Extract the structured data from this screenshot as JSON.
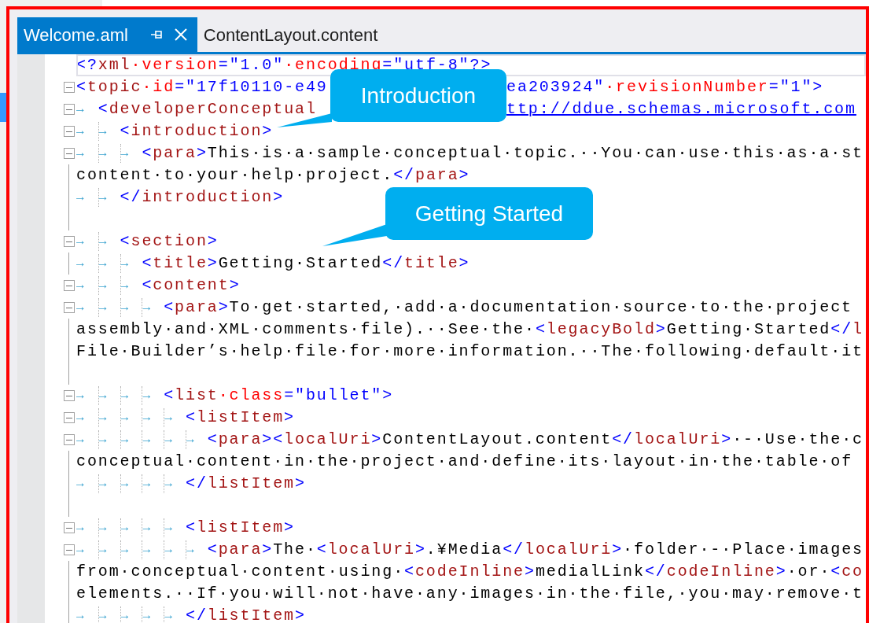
{
  "tabs": [
    {
      "label": "Welcome.aml",
      "selected": true
    },
    {
      "label": "ContentLayout.content",
      "selected": false
    }
  ],
  "editor": {
    "lines": [
      {
        "fold": false,
        "current": true,
        "tokens": [
          {
            "kind": "bracket",
            "text": "<?"
          },
          {
            "kind": "tag",
            "text": "xml"
          },
          {
            "kind": "attr",
            "text": "·version"
          },
          {
            "kind": "bracket",
            "text": "="
          },
          {
            "kind": "value",
            "text": "\"1.0\""
          },
          {
            "kind": "attr",
            "text": "·encoding"
          },
          {
            "kind": "bracket",
            "text": "="
          },
          {
            "kind": "value",
            "text": "\"utf-8\""
          },
          {
            "kind": "bracket",
            "text": "?>"
          }
        ]
      },
      {
        "fold": true,
        "current": false,
        "tokens": [
          {
            "kind": "bracket",
            "text": "<"
          },
          {
            "kind": "tag",
            "text": "topic"
          },
          {
            "kind": "attr",
            "text": "·id"
          },
          {
            "kind": "bracket",
            "text": "="
          },
          {
            "kind": "value",
            "text": "\"17f10110-e49"
          },
          {
            "kind": "hidden"
          },
          {
            "kind": "value",
            "text": "ea203924\""
          },
          {
            "kind": "attr",
            "text": "·revisionNumber"
          },
          {
            "kind": "bracket",
            "text": "="
          },
          {
            "kind": "value",
            "text": "\"1\""
          },
          {
            "kind": "bracket",
            "text": ">"
          }
        ]
      },
      {
        "fold": true,
        "current": false,
        "tabs": [
          "→"
        ],
        "tokens": [
          {
            "kind": "bracket",
            "text": "<"
          },
          {
            "kind": "tag",
            "text": "developerConceptual"
          },
          {
            "kind": "hidden"
          },
          {
            "kind": "link",
            "text": "ttp://ddue.schemas.microsoft.com"
          }
        ]
      },
      {
        "fold": true,
        "current": false,
        "tabs": [
          "→",
          "→"
        ],
        "tokens": [
          {
            "kind": "bracket",
            "text": "<"
          },
          {
            "kind": "tag",
            "text": "introduction"
          },
          {
            "kind": "bracket",
            "text": ">"
          }
        ]
      },
      {
        "fold": true,
        "current": false,
        "tabs": [
          "→",
          "→",
          "→"
        ],
        "tokens": [
          {
            "kind": "bracket",
            "text": "<"
          },
          {
            "kind": "tag",
            "text": "para"
          },
          {
            "kind": "bracket",
            "text": ">"
          },
          {
            "kind": "text",
            "text": "This·is·a·sample·conceptual·topic.··You·can·use·this·as·a·st"
          }
        ]
      },
      {
        "fold": false,
        "current": false,
        "tokens": [
          {
            "kind": "text",
            "text": "content·to·your·help·project."
          },
          {
            "kind": "bracket",
            "text": "</"
          },
          {
            "kind": "tag",
            "text": "para"
          },
          {
            "kind": "bracket",
            "text": ">"
          }
        ]
      },
      {
        "fold": false,
        "current": false,
        "tabs": [
          "→",
          "→"
        ],
        "tokens": [
          {
            "kind": "bracket",
            "text": "</"
          },
          {
            "kind": "tag",
            "text": "introduction"
          },
          {
            "kind": "bracket",
            "text": ">"
          }
        ]
      },
      {
        "fold": false,
        "current": false
      },
      {
        "fold": true,
        "current": false,
        "tabs": [
          "→",
          "→"
        ],
        "tokens": [
          {
            "kind": "bracket",
            "text": "<"
          },
          {
            "kind": "tag",
            "text": "section"
          },
          {
            "kind": "bracket",
            "text": ">"
          }
        ]
      },
      {
        "fold": false,
        "current": false,
        "tabs": [
          "→",
          "→",
          "→"
        ],
        "tokens": [
          {
            "kind": "bracket",
            "text": "<"
          },
          {
            "kind": "tag",
            "text": "title"
          },
          {
            "kind": "bracket",
            "text": ">"
          },
          {
            "kind": "text",
            "text": "Getting·Started"
          },
          {
            "kind": "bracket",
            "text": "</"
          },
          {
            "kind": "tag",
            "text": "title"
          },
          {
            "kind": "bracket",
            "text": ">"
          }
        ]
      },
      {
        "fold": true,
        "current": false,
        "tabs": [
          "→",
          "→",
          "→"
        ],
        "tokens": [
          {
            "kind": "bracket",
            "text": "<"
          },
          {
            "kind": "tag",
            "text": "content"
          },
          {
            "kind": "bracket",
            "text": ">"
          }
        ]
      },
      {
        "fold": true,
        "current": false,
        "tabs": [
          "→",
          "→",
          "→",
          "→"
        ],
        "tokens": [
          {
            "kind": "bracket",
            "text": "<"
          },
          {
            "kind": "tag",
            "text": "para"
          },
          {
            "kind": "bracket",
            "text": ">"
          },
          {
            "kind": "text",
            "text": "To·get·started,·add·a·documentation·source·to·the·project"
          }
        ]
      },
      {
        "fold": false,
        "current": false,
        "tokens": [
          {
            "kind": "text",
            "text": "assembly·and·XML·comments·file).··See·the·"
          },
          {
            "kind": "bracket",
            "text": "<"
          },
          {
            "kind": "tag",
            "text": "legacyBold"
          },
          {
            "kind": "bracket",
            "text": ">"
          },
          {
            "kind": "text",
            "text": "Getting·Started"
          },
          {
            "kind": "bracket",
            "text": "</"
          },
          {
            "kind": "tag",
            "text": "l"
          }
        ]
      },
      {
        "fold": false,
        "current": false,
        "tokens": [
          {
            "kind": "text",
            "text": "File·Builder’s·help·file·for·more·information.··The·following·default·it"
          }
        ]
      },
      {
        "fold": false,
        "current": false
      },
      {
        "fold": true,
        "current": false,
        "tabs": [
          "→",
          "→",
          "→",
          "→"
        ],
        "tokens": [
          {
            "kind": "bracket",
            "text": "<"
          },
          {
            "kind": "tag",
            "text": "list"
          },
          {
            "kind": "attr",
            "text": "·class"
          },
          {
            "kind": "bracket",
            "text": "="
          },
          {
            "kind": "value",
            "text": "\"bullet\""
          },
          {
            "kind": "bracket",
            "text": ">"
          }
        ]
      },
      {
        "fold": true,
        "current": false,
        "tabs": [
          "→",
          "→",
          "→",
          "→",
          "→"
        ],
        "tokens": [
          {
            "kind": "bracket",
            "text": "<"
          },
          {
            "kind": "tag",
            "text": "listItem"
          },
          {
            "kind": "bracket",
            "text": ">"
          }
        ]
      },
      {
        "fold": true,
        "current": false,
        "tabs": [
          "→",
          "→",
          "→",
          "→",
          "→",
          "→"
        ],
        "tokens": [
          {
            "kind": "bracket",
            "text": "<"
          },
          {
            "kind": "tag",
            "text": "para"
          },
          {
            "kind": "bracket",
            "text": "><"
          },
          {
            "kind": "tag",
            "text": "localUri"
          },
          {
            "kind": "bracket",
            "text": ">"
          },
          {
            "kind": "text",
            "text": "ContentLayout.content"
          },
          {
            "kind": "bracket",
            "text": "</"
          },
          {
            "kind": "tag",
            "text": "localUri"
          },
          {
            "kind": "bracket",
            "text": ">"
          },
          {
            "kind": "text",
            "text": "·-·Use·the·c"
          }
        ]
      },
      {
        "fold": false,
        "current": false,
        "tokens": [
          {
            "kind": "text",
            "text": "conceptual·content·in·the·project·and·define·its·layout·in·the·table·of"
          }
        ]
      },
      {
        "fold": false,
        "current": false,
        "tabs": [
          "→",
          "→",
          "→",
          "→",
          "→"
        ],
        "tokens": [
          {
            "kind": "bracket",
            "text": "</"
          },
          {
            "kind": "tag",
            "text": "listItem"
          },
          {
            "kind": "bracket",
            "text": ">"
          }
        ]
      },
      {
        "fold": false,
        "current": false
      },
      {
        "fold": true,
        "current": false,
        "tabs": [
          "→",
          "→",
          "→",
          "→",
          "→"
        ],
        "tokens": [
          {
            "kind": "bracket",
            "text": "<"
          },
          {
            "kind": "tag",
            "text": "listItem"
          },
          {
            "kind": "bracket",
            "text": ">"
          }
        ]
      },
      {
        "fold": true,
        "current": false,
        "tabs": [
          "→",
          "→",
          "→",
          "→",
          "→",
          "→"
        ],
        "tokens": [
          {
            "kind": "bracket",
            "text": "<"
          },
          {
            "kind": "tag",
            "text": "para"
          },
          {
            "kind": "bracket",
            "text": ">"
          },
          {
            "kind": "text",
            "text": "The·"
          },
          {
            "kind": "bracket",
            "text": "<"
          },
          {
            "kind": "tag",
            "text": "localUri"
          },
          {
            "kind": "bracket",
            "text": ">"
          },
          {
            "kind": "text",
            "text": ".¥Media"
          },
          {
            "kind": "bracket",
            "text": "</"
          },
          {
            "kind": "tag",
            "text": "localUri"
          },
          {
            "kind": "bracket",
            "text": ">"
          },
          {
            "kind": "text",
            "text": "·folder·-·Place·images"
          }
        ]
      },
      {
        "fold": false,
        "current": false,
        "tokens": [
          {
            "kind": "text",
            "text": "from·conceptual·content·using·"
          },
          {
            "kind": "bracket",
            "text": "<"
          },
          {
            "kind": "tag",
            "text": "codeInline"
          },
          {
            "kind": "bracket",
            "text": ">"
          },
          {
            "kind": "text",
            "text": "medialLink"
          },
          {
            "kind": "bracket",
            "text": "</"
          },
          {
            "kind": "tag",
            "text": "codeInline"
          },
          {
            "kind": "bracket",
            "text": ">"
          },
          {
            "kind": "text",
            "text": "·or·"
          },
          {
            "kind": "bracket",
            "text": "<"
          },
          {
            "kind": "tag",
            "text": "co"
          }
        ]
      },
      {
        "fold": false,
        "current": false,
        "tokens": [
          {
            "kind": "text",
            "text": "elements.··If·you·will·not·have·any·images·in·the·file,·you·may·remove·t"
          }
        ]
      },
      {
        "fold": false,
        "current": false,
        "tabs": [
          "→",
          "→",
          "→",
          "→",
          "→"
        ],
        "tokens": [
          {
            "kind": "bracket",
            "text": "</"
          },
          {
            "kind": "tag",
            "text": "listItem"
          },
          {
            "kind": "bracket",
            "text": ">"
          }
        ]
      }
    ]
  },
  "callouts": [
    {
      "text": "Introduction"
    },
    {
      "text": "Getting Started"
    }
  ]
}
